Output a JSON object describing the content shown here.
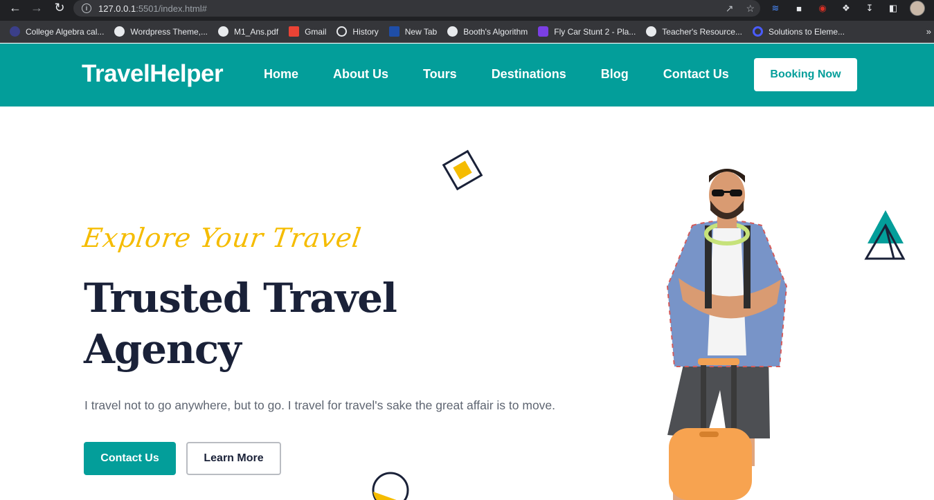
{
  "browser": {
    "url_host": "127.0.0.1",
    "url_path": ":5501/index.html#",
    "bookmarks": [
      {
        "label": "College Algebra cal..."
      },
      {
        "label": "Wordpress Theme,..."
      },
      {
        "label": "M1_Ans.pdf"
      },
      {
        "label": "Gmail"
      },
      {
        "label": "History"
      },
      {
        "label": "New Tab"
      },
      {
        "label": "Booth's Algorithm"
      },
      {
        "label": "Fly Car Stunt 2 - Pla..."
      },
      {
        "label": "Teacher's Resource..."
      },
      {
        "label": "Solutions to Eleme..."
      }
    ],
    "more": "»"
  },
  "header": {
    "logo": "TravelHelper",
    "nav": [
      "Home",
      "About Us",
      "Tours",
      "Destinations",
      "Blog",
      "Contact Us"
    ],
    "cta": "Booking Now"
  },
  "hero": {
    "script": "Explore Your Travel",
    "headline_line1": "Trusted Travel",
    "headline_line2": "Agency",
    "subtext": "I travel not to go anywhere, but to go. I travel for travel's sake the great affair is to move.",
    "primary_button": "Contact Us",
    "secondary_button": "Learn More"
  },
  "colors": {
    "brand": "#039e9a",
    "accent": "#f5bc00",
    "heading": "#1a2138"
  }
}
